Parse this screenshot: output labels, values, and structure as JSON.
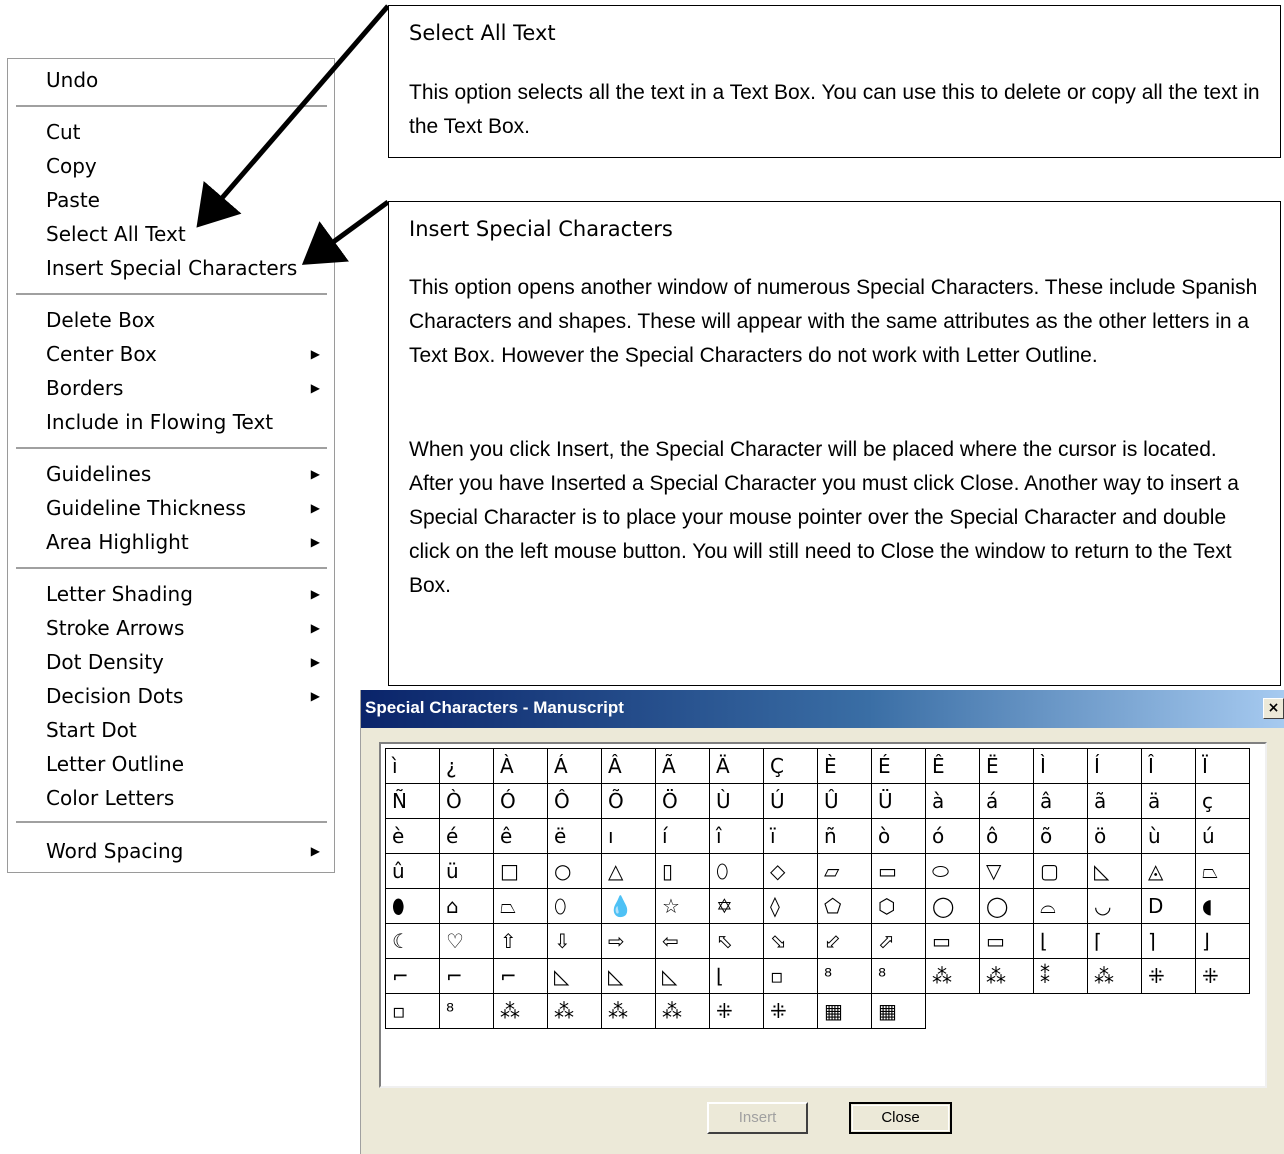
{
  "menu": {
    "items": [
      {
        "label": "Undo",
        "submenu": false
      },
      {
        "label": "Cut",
        "submenu": false
      },
      {
        "label": "Copy",
        "submenu": false
      },
      {
        "label": "Paste",
        "submenu": false
      },
      {
        "label": "Select All Text",
        "submenu": false
      },
      {
        "label": "Insert Special Characters",
        "submenu": false
      },
      {
        "label": "Delete Box",
        "submenu": false
      },
      {
        "label": "Center Box",
        "submenu": true
      },
      {
        "label": "Borders",
        "submenu": true
      },
      {
        "label": "Include in Flowing Text",
        "submenu": false
      },
      {
        "label": "Guidelines",
        "submenu": true
      },
      {
        "label": "Guideline Thickness",
        "submenu": true
      },
      {
        "label": "Area Highlight",
        "submenu": true
      },
      {
        "label": "Letter Shading",
        "submenu": true
      },
      {
        "label": "Stroke Arrows",
        "submenu": true
      },
      {
        "label": "Dot Density",
        "submenu": true
      },
      {
        "label": "Decision Dots",
        "submenu": true
      },
      {
        "label": "Start Dot",
        "submenu": false
      },
      {
        "label": "Letter Outline",
        "submenu": false
      },
      {
        "label": "Color Letters",
        "submenu": false
      },
      {
        "label": "Word Spacing",
        "submenu": true
      }
    ],
    "arrow_glyph": "▶"
  },
  "callouts": {
    "select_all": {
      "title": "Select All Text",
      "body": "This option selects all the text in a Text Box. You can use this to delete or copy all the text in the Text Box."
    },
    "insert_special": {
      "title": "Insert Special Characters",
      "body1": "This option opens another window of numerous Special Characters. These include Spanish Characters and shapes. These will appear with the same attributes as the other letters in a Text Box. However the Special Characters do not work with Letter Outline.",
      "body2": "When you click Insert, the Special Character will be placed where the cursor is located. After you have Inserted a Special Character you must click Close. Another way to insert a Special Character is to place your mouse pointer over the Special Character and double click on the left mouse button.  You will still need to Close the window to return to the Text Box."
    }
  },
  "dialog": {
    "title": "Special Characters - Manuscript",
    "close_glyph": "×",
    "insert_label": "Insert",
    "close_label": "Close",
    "title_gradient": [
      "#0a246a",
      "#3a6ea5",
      "#a6caf0"
    ],
    "grid": [
      [
        "ì",
        "¿",
        "À",
        "Á",
        "Â",
        "Ã",
        "Ä",
        "Ç",
        "È",
        "É",
        "Ê",
        "Ë",
        "Ì",
        "Í",
        "Î",
        "Ï"
      ],
      [
        "Ñ",
        "Ò",
        "Ó",
        "Ô",
        "Õ",
        "Ö",
        "Ù",
        "Ú",
        "Û",
        "Ü",
        "à",
        "á",
        "â",
        "ã",
        "ä",
        "ç"
      ],
      [
        "è",
        "é",
        "ê",
        "ë",
        "ı",
        "í",
        "î",
        "ï",
        "ñ",
        "ò",
        "ó",
        "ô",
        "õ",
        "ö",
        "ù",
        "ú"
      ],
      [
        "û",
        "ü",
        "□",
        "○",
        "△",
        "▯",
        "⬯",
        "◇",
        "▱",
        "▭",
        "⬭",
        "▽",
        "▢",
        "◺",
        "◬",
        "⏢"
      ],
      [
        "⬮",
        "⌂",
        "⏢",
        "⬯",
        "💧",
        "☆",
        "✡",
        "◊",
        "⬠",
        "⬡",
        "◯",
        "◯",
        "⌓",
        "◡",
        "D",
        "◖"
      ],
      [
        "☾",
        "♡",
        "⇧",
        "⇩",
        "⇨",
        "⇦",
        "⬁",
        "⬂",
        "⬃",
        "⬀",
        "▭",
        "▭",
        "⌊",
        "⌈",
        "⌉",
        "⌋"
      ],
      [
        "⌐",
        "⌐",
        "⌐",
        "◺",
        "◺",
        "◺",
        "⌊",
        "▫",
        "⁸",
        "⁸",
        "⁂",
        "⁂",
        "⁑",
        "⁂",
        "⁜",
        "⁜"
      ],
      [
        "▫",
        "⁸",
        "⁂",
        "⁂",
        "⁂",
        "⁂",
        "⁜",
        "⁜",
        "▦",
        "▦"
      ]
    ]
  }
}
